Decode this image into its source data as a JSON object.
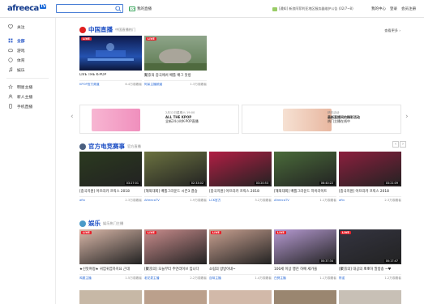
{
  "header": {
    "logo_text": "afreeca",
    "logo_badge": "TV",
    "search_placeholder": "",
    "live_button": "我的直播",
    "live_button_icon": "LIVE",
    "notice": "[通知] 新浪阿菲利亚地区服务器维护公告 (02/7~8)",
    "nav": [
      "我的中心",
      "登录",
      "会员注册"
    ]
  },
  "sidebar": {
    "items": [
      {
        "label": "关注",
        "icon": "heart-icon",
        "active": false
      },
      {
        "label": "全部",
        "icon": "grid-icon",
        "active": true
      },
      {
        "label": "游戏",
        "icon": "gamepad-icon",
        "active": false
      },
      {
        "label": "体育",
        "icon": "ball-icon",
        "active": false
      },
      {
        "label": "娱乐",
        "icon": "music-icon",
        "active": false
      }
    ],
    "items2": [
      {
        "label": "明星主播",
        "icon": "star-icon"
      },
      {
        "label": "新人主播",
        "icon": "user-icon"
      },
      {
        "label": "手机直播",
        "icon": "phone-icon"
      }
    ]
  },
  "section_china": {
    "title": "中国直播",
    "subtitle": "中国直播热门",
    "more": "查看更多 ›",
    "cards": [
      {
        "badge": "LIVE",
        "title": "LIVE THE K-POP",
        "channel": "KPOP官方频道",
        "viewers": "6.4万观看者",
        "color": "#1e3c8a"
      },
      {
        "badge": "LIVE",
        "title": "聚京의 중국에서 배틀 배그 맛방",
        "channel": "阿呆主播频道",
        "viewers": "1.3万观看者",
        "color": "#6f8a5c"
      }
    ]
  },
  "banners": [
    {
      "small": "2月12日星期六 19:00",
      "title": "ALL THE KPOP",
      "desc": "全新24小时K-POP直播",
      "color": "#f4a6c9"
    },
    {
      "small": "精彩活动",
      "title": "最新直播间的精彩活动",
      "desc": "热门主播在线中",
      "color": "#f1d7c8"
    }
  ],
  "section_esports": {
    "title": "官方电竞赛事",
    "subtitle": "官方直播",
    "cards": [
      {
        "title": "[중국지원] 아프리카 프릭스 2018",
        "channel": "aftv",
        "viewers": "2.3万观看者",
        "time": "03:27:01",
        "color": "#2b3a1f"
      },
      {
        "title": "[해외대회] 배틀그라운드 시즌3 결승",
        "channel": "AfreecaTV",
        "viewers": "1.9万观看者",
        "time": "02:33:02",
        "color": "#6b7240"
      },
      {
        "title": "[중국지원] 아프리카 프릭스 2018",
        "channel": "LCK官方",
        "viewers": "3.2万观看者",
        "time": "03:20:53",
        "color": "#b11e44"
      },
      {
        "title": "[해외대회] 배틀그라운드 하이라이트",
        "channel": "AfreecaTV",
        "viewers": "1.1万观看者",
        "time": "06:40:22",
        "color": "#4a6b3a"
      },
      {
        "title": "[중국지원] 아프리카 프릭스 2018",
        "channel": "aftv",
        "viewers": "2.3万观看者",
        "time": "03:21:09",
        "color": "#8c1f3e"
      }
    ]
  },
  "section_ent": {
    "title": "娱乐",
    "subtitle": "娱乐热门主播",
    "cards": [
      {
        "badge": "LIVE",
        "title": "★신맛여정★ 귀염귀염하지요 근데",
        "channel": "鸡翅主播",
        "viewers": "1.5万观看者",
        "color": "#d9b7a8"
      },
      {
        "badge": "LIVE",
        "title": "[聚京의] 오늘부터 주연라이브 입니다",
        "channel": "老花麦主播",
        "viewers": "2.2万观看者",
        "color": "#c98c8c"
      },
      {
        "badge": "LIVE",
        "title": "소림의 방방이네~",
        "channel": "百味主播",
        "viewers": "1.4万观看者",
        "color": "#c8a090"
      },
      {
        "badge": "LIVE",
        "title": "100세 이상 행진 하예 세가을",
        "channel": "白鸽主播",
        "viewers": "1.1万观看者",
        "time": "00:37:34",
        "color": "#b69ad2"
      },
      {
        "badge": "LIVE",
        "title": "[聚京의] 대공의 뽀뽀하 말방송 ~♥",
        "channel": "陈诺",
        "viewers": "1.2万观看者",
        "time": "00:17:47",
        "color": "#343440"
      }
    ]
  }
}
